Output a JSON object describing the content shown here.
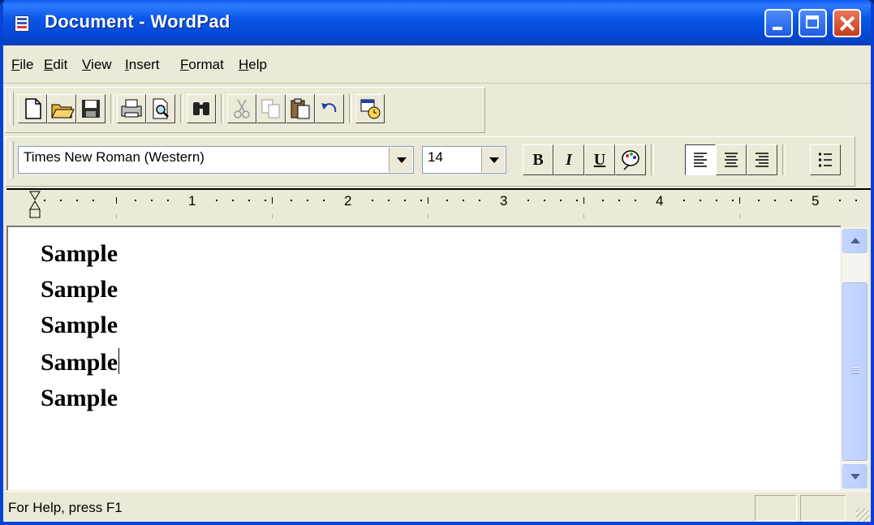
{
  "window": {
    "title": "Document - WordPad"
  },
  "menu": {
    "items": [
      "File",
      "Edit",
      "View",
      "Insert",
      "Format",
      "Help"
    ]
  },
  "format_bar": {
    "font_name": "Times New Roman (Western)",
    "font_size": "14",
    "bold_label": "B",
    "italic_label": "I",
    "underline_label": "U"
  },
  "ruler": {
    "numbers": [
      "1",
      "2",
      "3",
      "4",
      "5"
    ]
  },
  "document": {
    "lines": [
      "Sample",
      "Sample",
      "Sample",
      "Sample",
      "Sample"
    ]
  },
  "status": {
    "text": "For Help, press F1"
  },
  "colors": {
    "title_blue": "#0447d2",
    "chrome": "#ece9d8",
    "close_red": "#c43d1c"
  }
}
